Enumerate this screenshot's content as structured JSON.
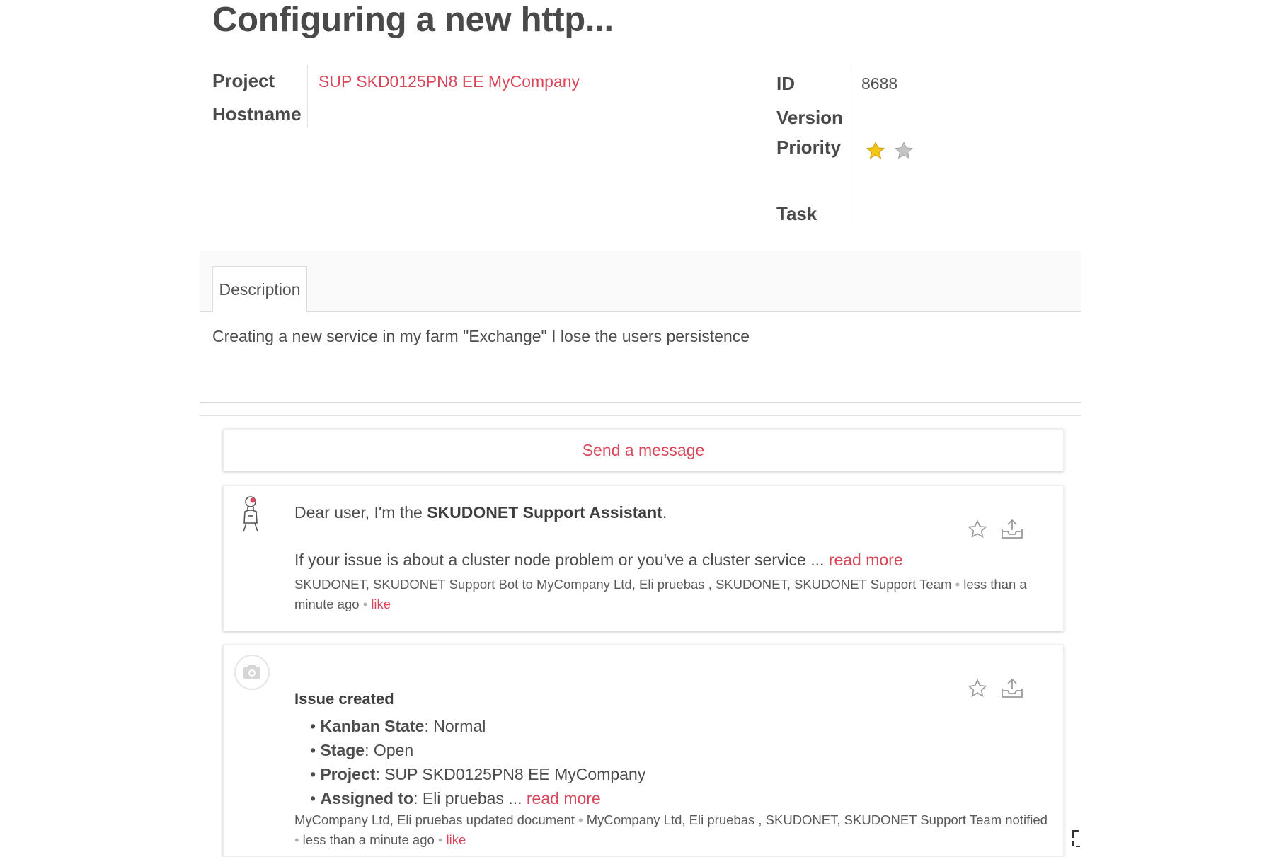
{
  "record": {
    "title": "Configuring a new http...",
    "left_fields": {
      "project_label": "Project",
      "project_value": "SUP SKD0125PN8 EE MyCompany",
      "hostname_label": "Hostname"
    },
    "right_fields": {
      "id_label": "ID",
      "id_value": "8688",
      "version_label": "Version",
      "priority_label": "Priority",
      "priority_stars_filled": 1,
      "priority_stars_total": 2,
      "task_label": "Task"
    }
  },
  "tabs": [
    {
      "label": "Description",
      "active": true
    }
  ],
  "description": "Creating a new service in my farm \"Exchange\" I lose the users persistence",
  "chatter": {
    "send_message_label": "Send a message",
    "messages": [
      {
        "avatar": "robot-avatar-icon",
        "intro_prefix": "Dear user, I'm the ",
        "intro_bold": "SKUDONET Support Assistant",
        "intro_suffix": ".",
        "body": "If your issue is about a cluster node problem or you've a cluster service ... ",
        "read_more": "read more",
        "recipients": "SKUDONET, SKUDONET Support Bot to MyCompany Ltd, Eli pruebas , SKUDONET, SKUDONET Support Team",
        "separator": "•",
        "time": "less than a minute ago",
        "like": "like"
      },
      {
        "avatar": "camera-placeholder-icon",
        "heading": "Issue created",
        "changes": [
          {
            "field": "Kanban State",
            "value": ": Normal"
          },
          {
            "field": "Stage",
            "value": ": Open"
          },
          {
            "field": "Project",
            "value": ": SUP SKD0125PN8 EE MyCompany"
          },
          {
            "field": "Assigned to",
            "value": ": Eli pruebas ... "
          }
        ],
        "bullet": "•",
        "read_more": "read more",
        "author_action": "MyCompany Ltd, Eli pruebas updated document",
        "recipients": "MyCompany Ltd, Eli pruebas , SKUDONET, SKUDONET Support Team notified",
        "separator": "•",
        "time": "less than a minute ago",
        "like": "like"
      }
    ]
  },
  "colors": {
    "link": "#d9465a",
    "star_filled": "#f5c518",
    "star_empty": "#bdbdbd",
    "heading": "#4a4a4a"
  }
}
